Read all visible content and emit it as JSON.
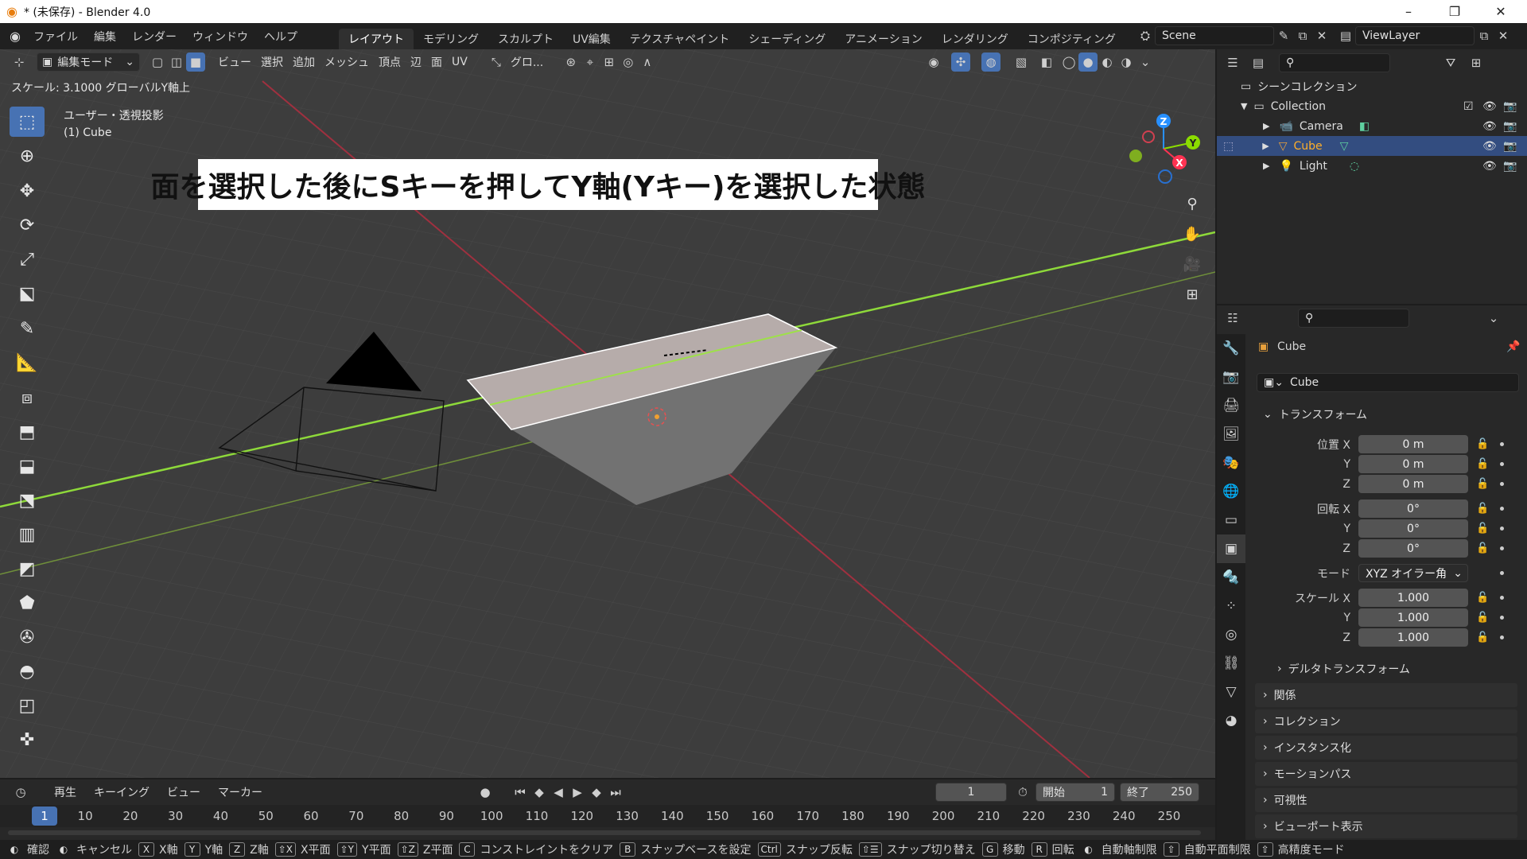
{
  "window": {
    "title": "* (未保存) - Blender 4.0",
    "minimize": "–",
    "maximize": "❐",
    "close": "✕"
  },
  "menu": [
    "ファイル",
    "編集",
    "レンダー",
    "ウィンドウ",
    "ヘルプ"
  ],
  "workspaces": [
    "レイアウト",
    "モデリング",
    "スカルプト",
    "UV編集",
    "テクスチャペイント",
    "シェーディング",
    "アニメーション",
    "レンダリング",
    "コンポジティング"
  ],
  "scene": {
    "name": "Scene",
    "viewlayer": "ViewLayer"
  },
  "viewport_header": {
    "mode": "編集モード",
    "items": [
      "ビュー",
      "選択",
      "追加",
      "メッシュ",
      "頂点",
      "辺",
      "面",
      "UV"
    ],
    "orientation": "グロ..."
  },
  "operator_status": "スケール: 3.1000 グローバルY軸上",
  "viewport_info": {
    "projection": "ユーザー・透視投影",
    "object": "(1) Cube"
  },
  "caption": "面を選択した後にSキーを押してY軸(Yキー)を選択した状態",
  "gizmo": {
    "x": "X",
    "y": "Y",
    "z": "Z"
  },
  "outliner": {
    "root": "シーンコレクション",
    "collection": "Collection",
    "items": [
      {
        "name": "Camera",
        "selected": false
      },
      {
        "name": "Cube",
        "selected": true
      },
      {
        "name": "Light",
        "selected": false
      }
    ]
  },
  "properties": {
    "object_name": "Cube",
    "data_name": "Cube",
    "transform_title": "トランスフォーム",
    "location": {
      "label": "位置 X",
      "x": "0 m",
      "y": "0 m",
      "z": "0 m"
    },
    "rotation": {
      "label": "回転 X",
      "x": "0°",
      "y": "0°",
      "z": "0°"
    },
    "mode_label": "モード",
    "mode_value": "XYZ オイラー角",
    "scale": {
      "label": "スケール X",
      "x": "1.000",
      "y": "1.000",
      "z": "1.000"
    },
    "axis_y": "Y",
    "axis_z": "Z",
    "delta": "デルタトランスフォーム",
    "panels": [
      "関係",
      "コレクション",
      "インスタンス化",
      "モーションパス",
      "可視性",
      "ビューポート表示"
    ]
  },
  "timeline": {
    "menus": [
      "再生",
      "キーイング",
      "ビュー",
      "マーカー"
    ],
    "current_frame": "1",
    "start_label": "開始",
    "start": "1",
    "end_label": "終了",
    "end": "250",
    "ticks": [
      "1",
      "10",
      "20",
      "30",
      "40",
      "50",
      "60",
      "70",
      "80",
      "90",
      "100",
      "110",
      "120",
      "130",
      "140",
      "150",
      "160",
      "170",
      "180",
      "190",
      "200",
      "210",
      "220",
      "230",
      "240",
      "250"
    ]
  },
  "statusbar": [
    {
      "key": "",
      "label": "確認"
    },
    {
      "key": "",
      "label": "キャンセル"
    },
    {
      "key": "X",
      "label": "X軸"
    },
    {
      "key": "Y",
      "label": "Y軸"
    },
    {
      "key": "Z",
      "label": "Z軸"
    },
    {
      "key": "⇧X",
      "label": "X平面"
    },
    {
      "key": "⇧Y",
      "label": "Y平面"
    },
    {
      "key": "⇧Z",
      "label": "Z平面"
    },
    {
      "key": "C",
      "label": "コンストレイントをクリア"
    },
    {
      "key": "B",
      "label": "スナップベースを設定"
    },
    {
      "key": "Ctrl",
      "label": "スナップ反転"
    },
    {
      "key": "⇧☰",
      "label": "スナップ切り替え"
    },
    {
      "key": "G",
      "label": "移動"
    },
    {
      "key": "R",
      "label": "回転"
    },
    {
      "key": "",
      "label": "自動軸制限"
    },
    {
      "key": "⇧",
      "label": "自動平面制限"
    },
    {
      "key": "⇧",
      "label": "高精度モード"
    }
  ],
  "colors": {
    "accent": "#4772b3",
    "selected_text": "#ffaf29",
    "x_axis": "#ff3352",
    "y_axis": "#8bdc00",
    "z_axis": "#2890ff"
  }
}
